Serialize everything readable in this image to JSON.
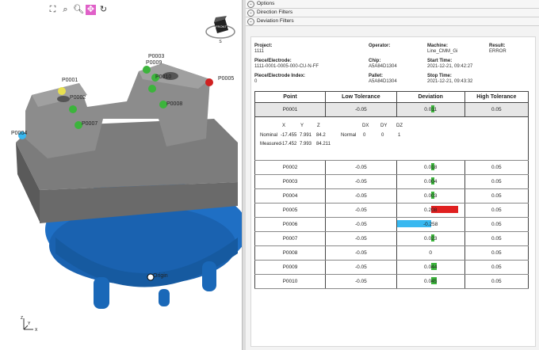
{
  "viewport": {
    "toolbar": [
      "fit-view",
      "zoom-window",
      "zoom",
      "pan",
      "rotate-reset"
    ],
    "cube_label": "FRONT",
    "axis_labels": {
      "z": "Z",
      "x": "X",
      "y": "Y"
    },
    "point_labels": [
      "P0003",
      "P0009",
      "P0010",
      "P0002",
      "P0001",
      "P0008",
      "P0005",
      "P0007",
      "P0004"
    ],
    "origin_label": "Origin"
  },
  "filters": [
    "Options",
    "Direction Filters",
    "Deviation Filters"
  ],
  "report": {
    "project_label": "Project:",
    "project": "1111",
    "operator_label": "Operator:",
    "operator": "",
    "machine_label": "Machine:",
    "machine": "Line_CMM_Gi",
    "result_label": "Result:",
    "result": "ERROR",
    "piece_label": "Piece/Electrode:",
    "piece": "1111-0001-0005-000-CU-N-FF",
    "chip_label": "Chip:",
    "chip": "A5A84D1304",
    "start_label": "Start Time:",
    "start": "2021-12-21, 09:42:27",
    "index_label": "Piece/Electrode Index:",
    "index": "0",
    "pallet_label": "Pallet:",
    "pallet": "A5A84D1304",
    "stop_label": "Stop Time:",
    "stop": "2021-12-21, 09:43:32"
  },
  "table": {
    "headers": [
      "Point",
      "Low Tolerance",
      "Deviation",
      "High Tolerance"
    ],
    "first": {
      "point": "P0001",
      "low": "-0.05",
      "dev": "0.011",
      "high": "0.05"
    },
    "detail": {
      "x": "X",
      "y": "Y",
      "z": "Z",
      "dx": "DX",
      "dy": "DY",
      "dz": "DZ",
      "nominal_label": "Nominal",
      "nominal_x": "-17.455",
      "nominal_y": "7.991",
      "nominal_z": "84.2",
      "normal_label": "Normal",
      "normal_dx": "0",
      "normal_dy": "0",
      "normal_dz": "1",
      "measured_label": "Measured",
      "measured_x": "-17.452",
      "measured_y": "7.993",
      "measured_z": "84.211"
    },
    "rows": [
      {
        "point": "P0002",
        "low": "-0.05",
        "dev": "0.018",
        "high": "0.05",
        "value": 0.018,
        "color": "#3cb43c"
      },
      {
        "point": "P0003",
        "low": "-0.05",
        "dev": "0.004",
        "high": "0.05",
        "value": 0.004,
        "color": "#3cb43c"
      },
      {
        "point": "P0004",
        "low": "-0.05",
        "dev": "0.003",
        "high": "0.05",
        "value": 0.003,
        "color": "#3cb43c"
      },
      {
        "point": "P0005",
        "low": "-0.05",
        "dev": "0.208",
        "high": "0.05",
        "value": 0.208,
        "color": "#e02020"
      },
      {
        "point": "P0006",
        "low": "-0.05",
        "dev": "-0.258",
        "high": "0.05",
        "value": -0.258,
        "color": "#38b8f0"
      },
      {
        "point": "P0007",
        "low": "-0.05",
        "dev": "0.023",
        "high": "0.05",
        "value": 0.023,
        "color": "#3cb43c"
      },
      {
        "point": "P0008",
        "low": "-0.05",
        "dev": "0",
        "high": "0.05",
        "value": 0,
        "color": "#3cb43c"
      },
      {
        "point": "P0009",
        "low": "-0.05",
        "dev": "0.044",
        "high": "0.05",
        "value": 0.044,
        "color": "#3cb43c"
      },
      {
        "point": "P0010",
        "low": "-0.05",
        "dev": "0.045",
        "high": "0.05",
        "value": 0.045,
        "color": "#3cb43c"
      }
    ],
    "first_value": 0.011,
    "first_color": "#3cb43c"
  }
}
